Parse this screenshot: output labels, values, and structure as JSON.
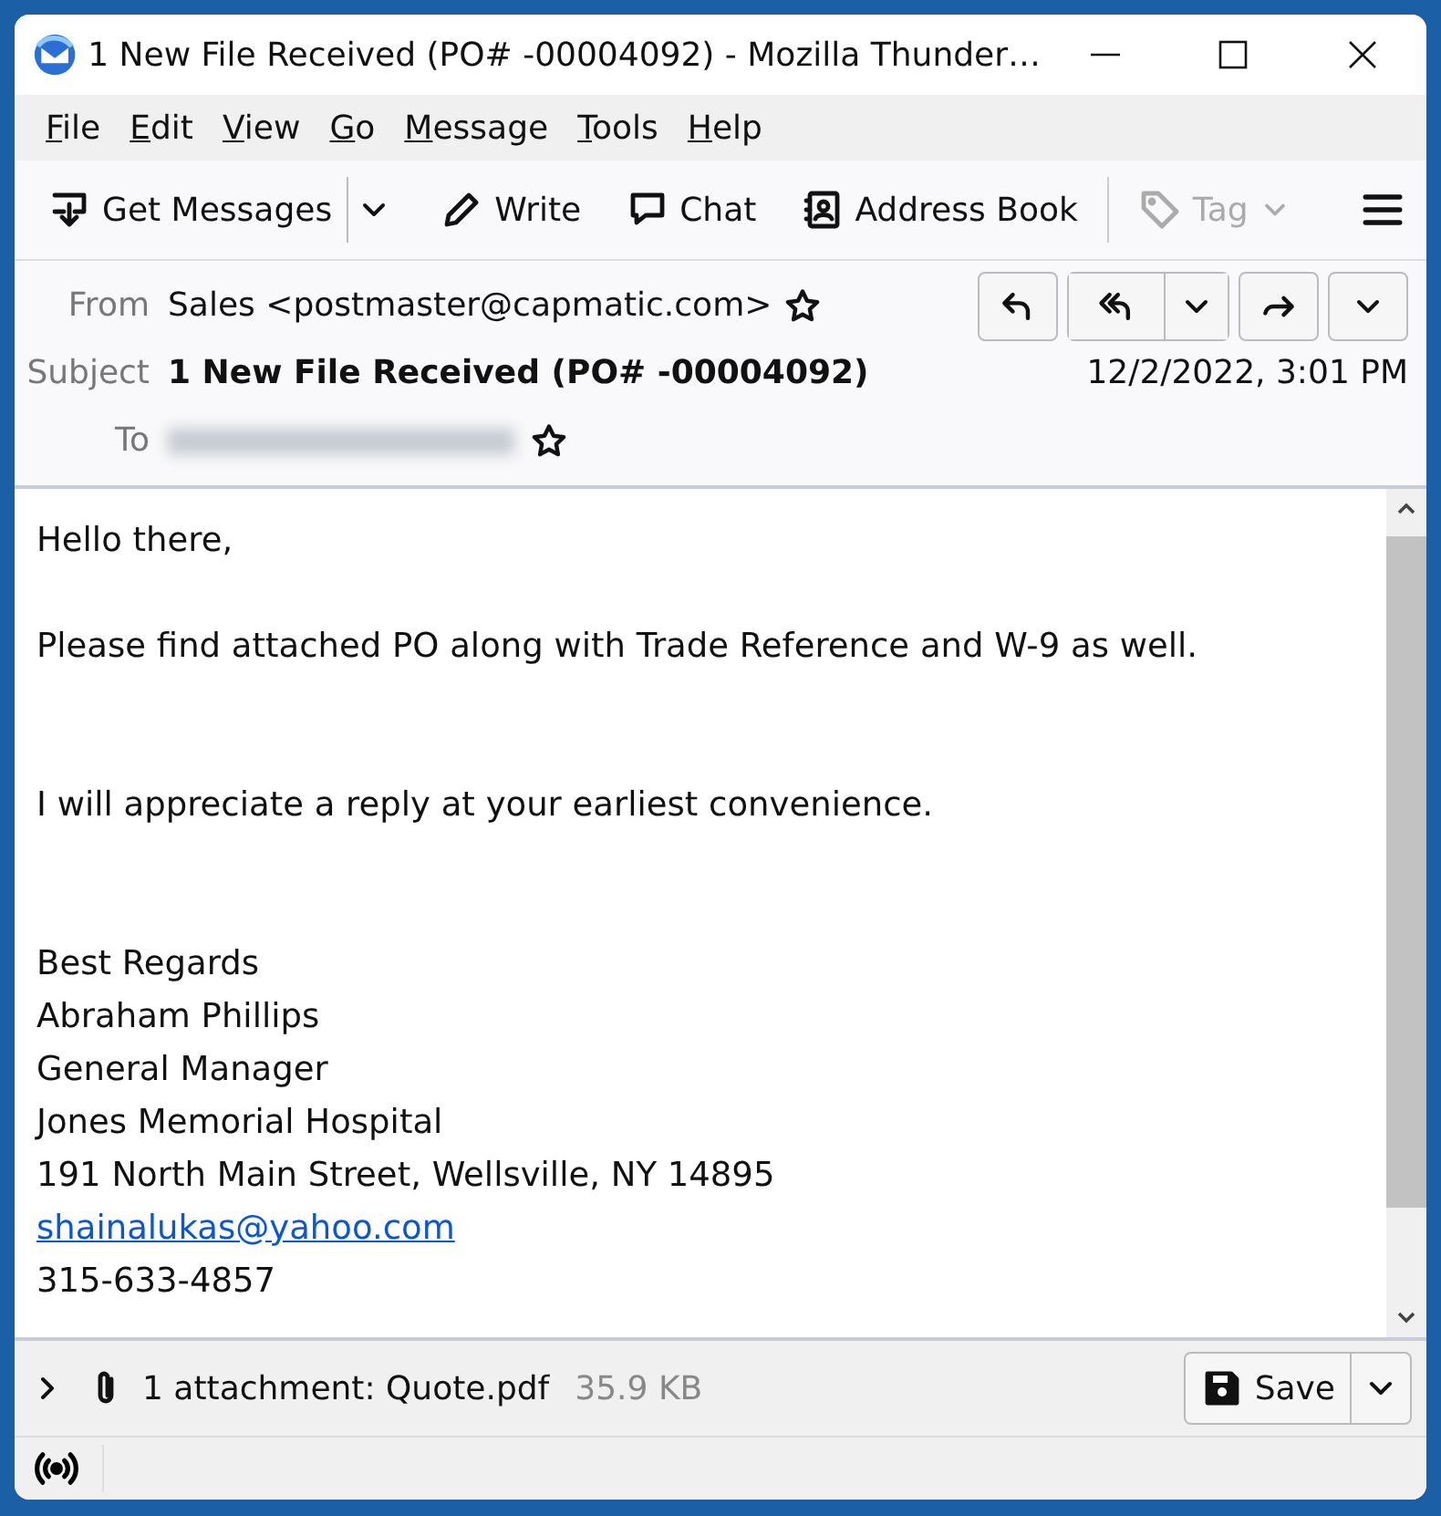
{
  "window": {
    "title": "1 New File Received (PO# -00004092) - Mozilla Thunder…"
  },
  "menu": [
    "File",
    "Edit",
    "View",
    "Go",
    "Message",
    "Tools",
    "Help"
  ],
  "toolbar": [
    {
      "label": "Get Messages",
      "kind": "split",
      "disabled": false
    },
    {
      "label": "Write",
      "kind": "plain",
      "disabled": false
    },
    {
      "label": "Chat",
      "kind": "plain",
      "disabled": false
    },
    {
      "label": "Address Book",
      "kind": "plain",
      "disabled": false
    },
    {
      "label": "Tag",
      "kind": "menu",
      "disabled": true
    }
  ],
  "header": {
    "from": {
      "label": "From",
      "value": "Sales <postmaster@capmatic.com>"
    },
    "subject": {
      "label": "Subject",
      "value": "1 New File Received (PO# -00004092)"
    },
    "date": "12/2/2022, 3:01 PM",
    "to": {
      "label": "To"
    }
  },
  "body": [
    {
      "lines": [
        {
          "kind": "text",
          "text": "Hello there,"
        }
      ]
    },
    {
      "lines": [
        {
          "kind": "text",
          "text": "Please find attached PO along with Trade Reference and W-9 as well."
        }
      ]
    },
    {
      "lines": [
        {
          "kind": "text",
          "text": "I will appreciate a reply at your earliest convenience."
        }
      ]
    },
    {
      "lines": [
        {
          "kind": "text",
          "text": "Best Regards"
        },
        {
          "kind": "text",
          "text": "Abraham Phillips"
        },
        {
          "kind": "text",
          "text": "General Manager"
        },
        {
          "kind": "text",
          "text": "Jones Memorial Hospital"
        },
        {
          "kind": "text",
          "text": "191 North Main Street, Wellsville, NY 14895"
        },
        {
          "kind": "link",
          "text": "shainalukas@yahoo.com"
        },
        {
          "kind": "text",
          "text": "315-633-4857"
        }
      ]
    }
  ],
  "attachments": {
    "expanded": false,
    "summary": "1 attachment: Quote.pdf",
    "size": "35.9 KB",
    "save": "Save"
  }
}
